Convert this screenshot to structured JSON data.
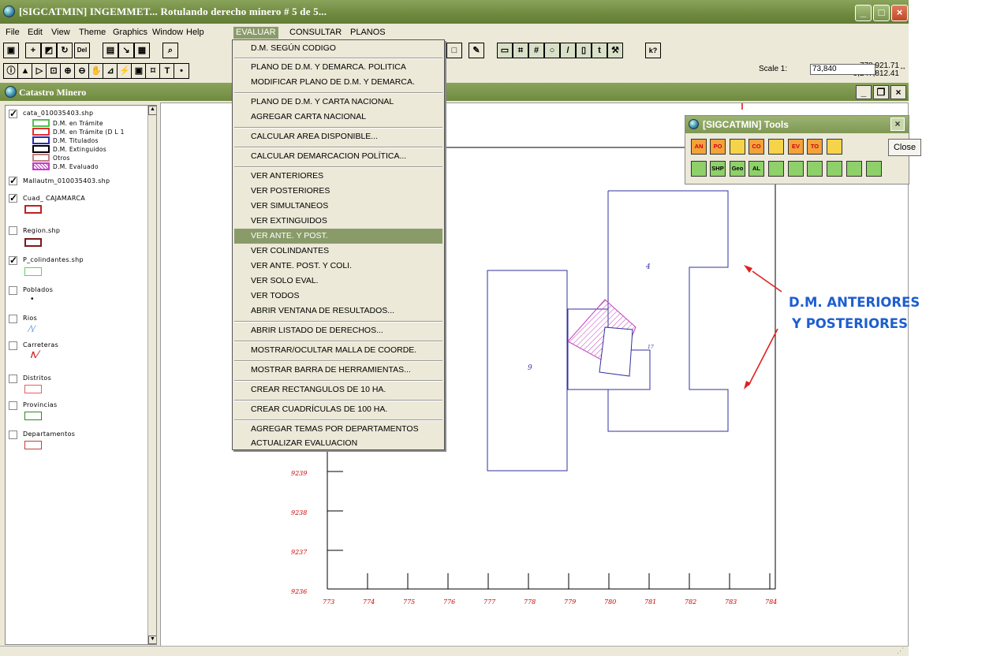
{
  "window": {
    "title": "[SIGCATMIN] INGEMMET... Rotulando derecho minero # 5 de 5..."
  },
  "menubar": [
    "File",
    "Edit",
    "View",
    "Theme",
    "Graphics",
    "Window",
    "Help",
    "EVALUAR",
    "CONSULTAR",
    "PLANOS"
  ],
  "toolbar": {
    "del_label": "Del",
    "help_glyph": "k?",
    "scale_label": "Scale 1:",
    "scale_value": "73,840",
    "coord_x": "778,921.71",
    "coord_y": "9,247,812.41",
    "text_tool": "T"
  },
  "catastro": {
    "title": "Catastro Minero"
  },
  "toc": {
    "themes": [
      {
        "name": "cata_010035403.shp",
        "checked": true
      },
      {
        "name": "Mallautm_010035403.shp",
        "checked": true
      },
      {
        "name": "Cuad_ CAJAMARCA",
        "checked": true
      },
      {
        "name": "Region.shp",
        "checked": false
      },
      {
        "name": "P_colindantes.shp",
        "checked": true
      },
      {
        "name": "Poblados",
        "checked": false
      },
      {
        "name": "Rios",
        "checked": false
      },
      {
        "name": "Carreteras",
        "checked": false
      },
      {
        "name": "Distritos",
        "checked": false
      },
      {
        "name": "Provincias",
        "checked": false
      },
      {
        "name": "Departamentos",
        "checked": false
      }
    ],
    "cata_legend": [
      "D.M. en Trámite",
      "D.M. en Trámite (D L 1",
      "D.M. Titulados",
      "D.M. Extinguidos",
      "Otros",
      "D.M. Evaluado"
    ],
    "cata_legend_colors": [
      "#4fc14f",
      "#e03030",
      "#2a2ab0",
      "#000000",
      "#c08080",
      "#c040c0"
    ]
  },
  "evaluar_menu": {
    "items": [
      "D.M. SEGÚN CODIGO",
      "PLANO DE D.M. Y DEMARCA. POLITICA",
      "MODIFICAR PLANO DE D.M. Y DEMARCA.",
      "PLANO DE D.M. Y CARTA NACIONAL",
      "AGREGAR CARTA NACIONAL",
      "CALCULAR AREA DISPONIBLE...",
      "CALCULAR DEMARCACION POLÍTICA...",
      "VER ANTERIORES",
      "VER POSTERIORES",
      "VER SIMULTANEOS",
      "VER EXTINGUIDOS",
      "VER ANTE. Y POST.",
      "VER COLINDANTES",
      "VER ANTE. POST. Y COLI.",
      "VER SOLO EVAL.",
      "VER TODOS",
      "ABRIR VENTANA DE RESULTADOS...",
      "ABRIR LISTADO DE DERECHOS...",
      "MOSTRAR/OCULTAR MALLA DE COORDE.",
      "MOSTRAR BARRA DE HERRAMIENTAS...",
      "CREAR RECTANGULOS DE 10 HA.",
      "CREAR CUADRÍCULAS DE 100 HA.",
      "AGREGAR TEMAS POR DEPARTAMENTOS",
      "ACTUALIZAR EVALUACION"
    ],
    "highlighted": "VER ANTE. Y POST."
  },
  "tools_window": {
    "title": "[SIGCATMIN] Tools",
    "close_label": "Close",
    "row1": [
      "AN",
      "PO",
      "",
      "CO",
      "",
      "EV",
      "TO",
      ""
    ],
    "row2": [
      "",
      "SHP",
      "Geo",
      "AL",
      "",
      "",
      "",
      "",
      "",
      ""
    ]
  },
  "map": {
    "y_ticks": [
      "9239",
      "9238",
      "9237",
      "9236"
    ],
    "x_ticks": [
      "773",
      "774",
      "775",
      "776",
      "777",
      "778",
      "779",
      "780",
      "781",
      "782",
      "783",
      "784"
    ],
    "polygon_labels": [
      "4",
      "9",
      "17"
    ]
  },
  "annotation": {
    "line1": "D.M. ANTERIORES",
    "line2": "Y POSTERIORES",
    "color": "#1d5ed0",
    "arrow_color": "#e02020"
  }
}
